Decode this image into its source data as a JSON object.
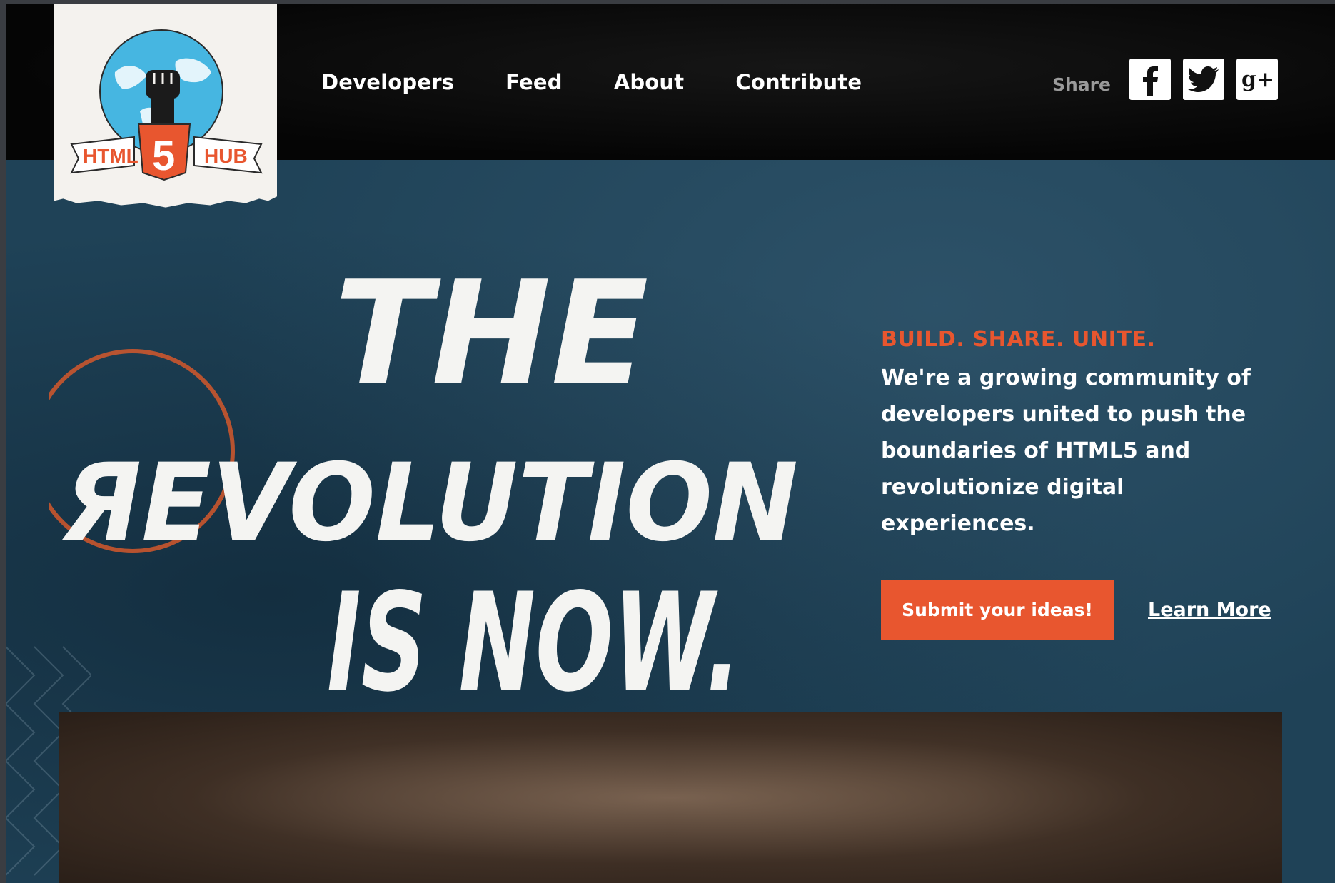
{
  "nav": {
    "items": [
      "Developers",
      "Feed",
      "About",
      "Contribute"
    ]
  },
  "share": {
    "label": "Share",
    "icons": [
      "facebook-icon",
      "twitter-icon",
      "google-plus-icon"
    ]
  },
  "logo": {
    "text_left": "HTML",
    "text_center": "5",
    "text_right": "HUB"
  },
  "hero": {
    "headline_lines": [
      "THE",
      "ЯEVOLUTION",
      "IS NOW."
    ],
    "tagline": "BUILD. SHARE. UNITE.",
    "intro": "We're a growing community of developers united to push the boundaries of HTML5 and revolutionize digital experiences.",
    "cta_label": "Submit your ideas!",
    "learn_more_label": "Learn More"
  },
  "colors": {
    "accent": "#e8562f",
    "header_bg": "#050505",
    "hero_bg": "#1f4257",
    "text": "#ffffff"
  }
}
